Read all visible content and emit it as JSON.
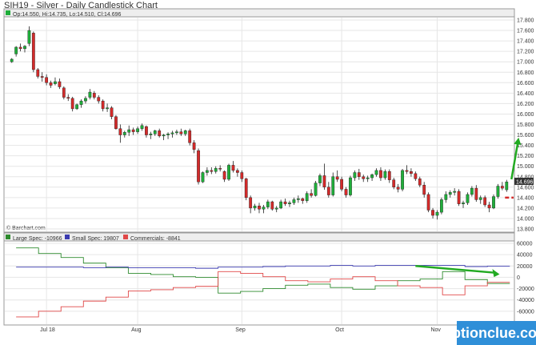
{
  "title": "SIH19 - Silver - Daily Candlestick Chart",
  "watermark": "optionclue.com",
  "chart_data": [
    {
      "type": "candlestick",
      "ohlc_label": "Op:14.550, Hi:14.735, Lo:14.510, Cl:14.696",
      "source_label": "© Barchart.com",
      "last_price_label": "14.696",
      "ylim": [
        13.8,
        17.8
      ],
      "yticks": [
        13.8,
        14.0,
        14.2,
        14.4,
        14.6,
        14.8,
        15.0,
        15.2,
        15.4,
        15.6,
        15.8,
        16.0,
        16.2,
        16.4,
        16.6,
        16.8,
        17.0,
        17.2,
        17.4,
        17.6,
        17.8
      ],
      "colors": {
        "up": "#1fae3a",
        "down": "#d42a2a",
        "arrow": "#22aa22",
        "dash": "#d42a2a"
      },
      "candles": [
        [
          17.0,
          17.07,
          16.98,
          17.05
        ],
        [
          17.15,
          17.3,
          17.1,
          17.28
        ],
        [
          17.28,
          17.35,
          17.2,
          17.25
        ],
        [
          17.25,
          17.32,
          17.18,
          17.3
        ],
        [
          17.35,
          17.68,
          17.3,
          17.6
        ],
        [
          17.55,
          17.58,
          16.8,
          16.85
        ],
        [
          16.85,
          16.88,
          16.68,
          16.72
        ],
        [
          16.72,
          16.8,
          16.62,
          16.7
        ],
        [
          16.7,
          16.76,
          16.55,
          16.6
        ],
        [
          16.6,
          16.64,
          16.5,
          16.55
        ],
        [
          16.58,
          16.7,
          16.55,
          16.62
        ],
        [
          16.62,
          16.68,
          16.48,
          16.52
        ],
        [
          16.5,
          16.53,
          16.28,
          16.32
        ],
        [
          16.32,
          16.38,
          16.25,
          16.3
        ],
        [
          16.3,
          16.33,
          16.05,
          16.1
        ],
        [
          16.1,
          16.2,
          16.08,
          16.18
        ],
        [
          16.18,
          16.28,
          16.12,
          16.25
        ],
        [
          16.25,
          16.34,
          16.2,
          16.3
        ],
        [
          16.32,
          16.48,
          16.28,
          16.42
        ],
        [
          16.4,
          16.44,
          16.28,
          16.32
        ],
        [
          16.32,
          16.36,
          16.2,
          16.25
        ],
        [
          16.25,
          16.28,
          16.05,
          16.1
        ],
        [
          16.1,
          16.2,
          16.04,
          16.12
        ],
        [
          16.12,
          16.15,
          15.9,
          15.95
        ],
        [
          15.95,
          15.98,
          15.7,
          15.72
        ],
        [
          15.72,
          15.8,
          15.45,
          15.6
        ],
        [
          15.6,
          15.68,
          15.55,
          15.65
        ],
        [
          15.65,
          15.78,
          15.58,
          15.7
        ],
        [
          15.7,
          15.74,
          15.6,
          15.66
        ],
        [
          15.66,
          15.76,
          15.62,
          15.72
        ],
        [
          15.72,
          15.82,
          15.68,
          15.78
        ],
        [
          15.76,
          15.78,
          15.55,
          15.6
        ],
        [
          15.6,
          15.66,
          15.52,
          15.62
        ],
        [
          15.62,
          15.7,
          15.58,
          15.68
        ],
        [
          15.68,
          15.72,
          15.55,
          15.58
        ],
        [
          15.58,
          15.62,
          15.5,
          15.6
        ],
        [
          15.6,
          15.65,
          15.52,
          15.62
        ],
        [
          15.62,
          15.68,
          15.55,
          15.64
        ],
        [
          15.64,
          15.7,
          15.6,
          15.66
        ],
        [
          15.66,
          15.72,
          15.58,
          15.62
        ],
        [
          15.62,
          15.7,
          15.58,
          15.68
        ],
        [
          15.68,
          15.72,
          15.4,
          15.45
        ],
        [
          15.45,
          15.5,
          15.25,
          15.32
        ],
        [
          15.3,
          15.34,
          14.65,
          14.7
        ],
        [
          14.7,
          14.9,
          14.68,
          14.88
        ],
        [
          14.88,
          14.98,
          14.82,
          14.92
        ],
        [
          14.92,
          14.98,
          14.85,
          14.9
        ],
        [
          14.9,
          15.0,
          14.86,
          14.96
        ],
        [
          14.96,
          15.02,
          14.9,
          14.95
        ],
        [
          14.9,
          14.92,
          14.7,
          14.75
        ],
        [
          14.75,
          15.05,
          14.72,
          15.02
        ],
        [
          15.02,
          15.1,
          14.88,
          14.92
        ],
        [
          14.92,
          14.96,
          14.8,
          14.88
        ],
        [
          14.88,
          14.92,
          14.7,
          14.76
        ],
        [
          14.76,
          14.78,
          14.35,
          14.4
        ],
        [
          14.4,
          14.44,
          14.1,
          14.2
        ],
        [
          14.2,
          14.28,
          14.15,
          14.24
        ],
        [
          14.24,
          14.3,
          14.1,
          14.18
        ],
        [
          14.18,
          14.26,
          14.1,
          14.22
        ],
        [
          14.22,
          14.36,
          14.18,
          14.32
        ],
        [
          14.32,
          14.34,
          14.15,
          14.18
        ],
        [
          14.18,
          14.24,
          14.12,
          14.2
        ],
        [
          14.2,
          14.36,
          14.18,
          14.32
        ],
        [
          14.32,
          14.38,
          14.24,
          14.28
        ],
        [
          14.28,
          14.34,
          14.22,
          14.3
        ],
        [
          14.3,
          14.4,
          14.26,
          14.36
        ],
        [
          14.36,
          14.44,
          14.3,
          14.38
        ],
        [
          14.38,
          14.4,
          14.28,
          14.34
        ],
        [
          14.34,
          14.52,
          14.3,
          14.48
        ],
        [
          14.48,
          14.56,
          14.4,
          14.44
        ],
        [
          14.44,
          14.72,
          14.42,
          14.68
        ],
        [
          14.68,
          14.86,
          14.62,
          14.82
        ],
        [
          14.82,
          15.05,
          14.55,
          14.6
        ],
        [
          14.6,
          14.7,
          14.4,
          14.45
        ],
        [
          14.45,
          14.88,
          14.42,
          14.8
        ],
        [
          14.8,
          14.92,
          14.7,
          14.75
        ],
        [
          14.75,
          14.8,
          14.52,
          14.56
        ],
        [
          14.56,
          14.6,
          14.4,
          14.45
        ],
        [
          14.45,
          14.82,
          14.42,
          14.78
        ],
        [
          14.78,
          14.92,
          14.72,
          14.88
        ],
        [
          14.88,
          14.95,
          14.74,
          14.8
        ],
        [
          14.8,
          14.84,
          14.7,
          14.76
        ],
        [
          14.76,
          14.82,
          14.7,
          14.78
        ],
        [
          14.78,
          14.86,
          14.72,
          14.84
        ],
        [
          14.84,
          14.96,
          14.8,
          14.92
        ],
        [
          14.92,
          14.98,
          14.72,
          14.78
        ],
        [
          14.78,
          14.94,
          14.74,
          14.9
        ],
        [
          14.9,
          14.94,
          14.68,
          14.74
        ],
        [
          14.74,
          14.78,
          14.56,
          14.6
        ],
        [
          14.6,
          14.66,
          14.5,
          14.56
        ],
        [
          14.56,
          14.95,
          14.52,
          14.92
        ],
        [
          14.92,
          15.02,
          14.85,
          14.9
        ],
        [
          14.9,
          14.96,
          14.8,
          14.86
        ],
        [
          14.86,
          14.9,
          14.72,
          14.76
        ],
        [
          14.76,
          14.8,
          14.6,
          14.64
        ],
        [
          14.64,
          14.7,
          14.4,
          14.46
        ],
        [
          14.46,
          14.5,
          14.12,
          14.16
        ],
        [
          14.16,
          14.2,
          14.0,
          14.06
        ],
        [
          14.06,
          14.16,
          13.98,
          14.12
        ],
        [
          14.12,
          14.4,
          14.08,
          14.36
        ],
        [
          14.36,
          14.52,
          14.3,
          14.46
        ],
        [
          14.46,
          14.54,
          14.4,
          14.5
        ],
        [
          14.5,
          14.58,
          14.44,
          14.52
        ],
        [
          14.52,
          14.56,
          14.24,
          14.28
        ],
        [
          14.28,
          14.34,
          14.2,
          14.3
        ],
        [
          14.3,
          14.5,
          14.26,
          14.46
        ],
        [
          14.46,
          14.62,
          14.42,
          14.58
        ],
        [
          14.58,
          14.64,
          14.32,
          14.36
        ],
        [
          14.36,
          14.44,
          14.28,
          14.4
        ],
        [
          14.4,
          14.44,
          14.22,
          14.26
        ],
        [
          14.26,
          14.32,
          14.12,
          14.2
        ],
        [
          14.2,
          14.46,
          14.18,
          14.42
        ],
        [
          14.42,
          14.66,
          14.38,
          14.62
        ],
        [
          14.62,
          14.7,
          14.54,
          14.58
        ],
        [
          14.55,
          14.74,
          14.51,
          14.7
        ]
      ],
      "dash_level": 14.4
    },
    {
      "type": "line",
      "ylim": [
        -80000,
        60000
      ],
      "yticks": [
        60000,
        40000,
        20000,
        0,
        -20000,
        -40000,
        -60000
      ],
      "x_tick_labels": [
        "Jul 18",
        "Aug",
        "Sep",
        "Oct",
        "Nov"
      ],
      "x_tick_index": [
        8,
        29,
        53,
        76,
        98
      ],
      "series": [
        {
          "name": "Large Spec: -10966",
          "color": "#2e8b2e",
          "values": [
            52000,
            42000,
            35000,
            25000,
            17000,
            7000,
            5000,
            1000,
            0,
            -28000,
            -25000,
            -20000,
            -14000,
            -12000,
            -18000,
            -21000,
            -15000,
            -6000,
            -3000,
            10000,
            -4000,
            -10966
          ]
        },
        {
          "name": "Small Spec: 19807",
          "color": "#3b3bb0",
          "values": [
            18000,
            18000,
            18000,
            17000,
            18000,
            17000,
            17000,
            17000,
            16000,
            18000,
            18000,
            19000,
            20000,
            20000,
            21000,
            20000,
            21000,
            21000,
            21000,
            21000,
            19000,
            19807
          ]
        },
        {
          "name": "Commercials: -8841",
          "color": "#e04848",
          "values": [
            -70000,
            -60000,
            -52000,
            -42000,
            -35000,
            -24000,
            -22000,
            -18000,
            -16000,
            10000,
            7000,
            1000,
            -6000,
            -8000,
            -3000,
            1000,
            -6000,
            -15000,
            -18000,
            -31000,
            -15000,
            -8841
          ]
        }
      ]
    }
  ]
}
